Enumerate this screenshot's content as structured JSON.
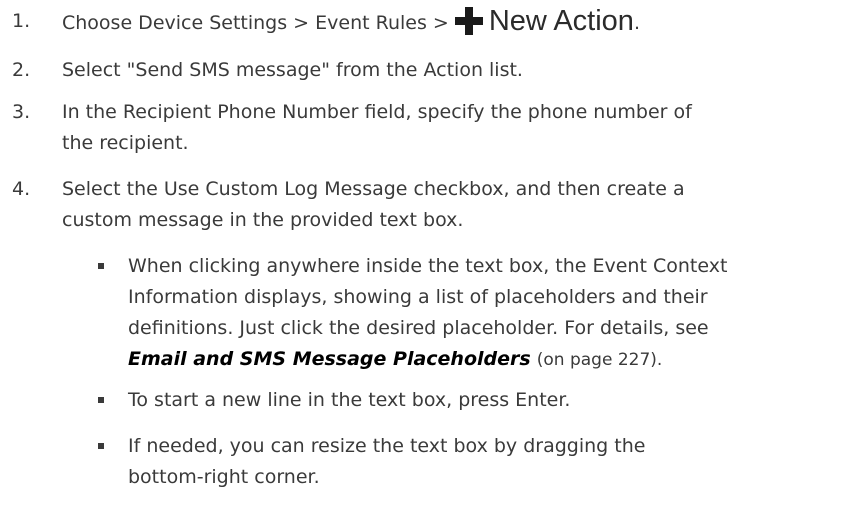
{
  "steps": [
    {
      "num": "1.",
      "text_before": "Choose Device Settings > Event Rules > ",
      "button_label": "New Action",
      "button_icon": "plus-icon",
      "text_after": "."
    },
    {
      "num": "2.",
      "text": "Select \"Send SMS message\" from the Action list."
    },
    {
      "num": "3.",
      "line1": "In the Recipient Phone Number field, specify the phone number of",
      "line2": "the recipient."
    },
    {
      "num": "4.",
      "line1": "Select the Use Custom Log Message checkbox, and then create a",
      "line2": "custom message in the provided text box."
    }
  ],
  "bullets": [
    {
      "line1": "When clicking anywhere inside the text box, the Event Context",
      "line2": "Information displays, showing a list of placeholders and their",
      "line3_before": "definitions. Just click the desired placeholder. For details, see",
      "link_text": "Email and SMS Message Placeholders",
      "link_after": "(on page 227)."
    },
    {
      "line1": "To start a new line in the text box, press Enter."
    },
    {
      "line1": "If needed, you can resize the text box by dragging the",
      "line2": "bottom-right corner."
    }
  ]
}
